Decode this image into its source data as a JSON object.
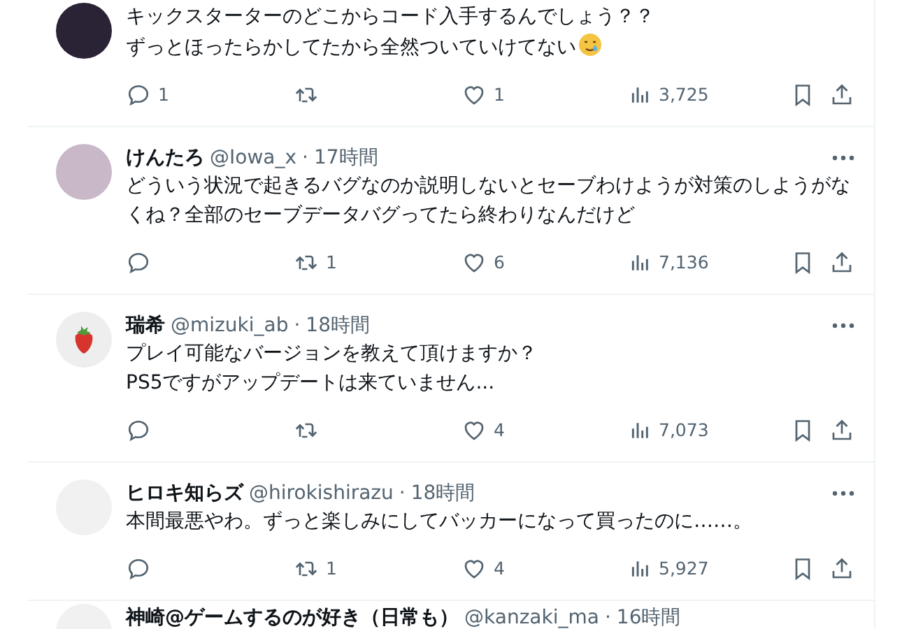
{
  "tweets": [
    {
      "kind": "dark",
      "lines": [
        "キックスターターのどこからコード入手するんでしょう？？",
        "ずっとほったらかしてたから全然ついていけてない"
      ],
      "inline_icons": [
        {
          "kind": "tear-smile"
        }
      ],
      "replies": "1",
      "likes": "1",
      "views": "3,725"
    },
    {
      "kind": "portrait",
      "name": "けんたろ",
      "handle": "@Iowa_x",
      "dot": "·",
      "time": "17時間",
      "lines": [
        "どういう状況で起きるバグなのか説明しないとセーブわけようが対策のしようがなくね？全部のセーブデータバグってたら終わりなんだけど"
      ],
      "retweets": "1",
      "likes": "6",
      "views": "7,136",
      "more": true
    },
    {
      "kind": "strawberry",
      "name": "瑞希",
      "handle": "@mizuki_ab",
      "dot": "·",
      "time": "18時間",
      "lines": [
        "プレイ可能なバージョンを教えて頂けますか？",
        "PS5ですがアップデートは来ていません..."
      ],
      "likes": "4",
      "views": "7,073",
      "more": true
    },
    {
      "kind": "sketch",
      "name": "ヒロキ知らズ",
      "handle": "@hirokishirazu",
      "dot": "·",
      "time": "18時間",
      "lines": [
        "本間最悪やわ。ずっと楽しみにしてバッカーになって買ったのに……。"
      ],
      "retweets": "1",
      "likes": "4",
      "views": "5,927",
      "more": true
    },
    {
      "kind": "sketch",
      "name": "神崎@ゲームするのが好き（日常も）",
      "handle": "@kanzaki_ma",
      "dot": "·",
      "time": "16時間"
    }
  ]
}
